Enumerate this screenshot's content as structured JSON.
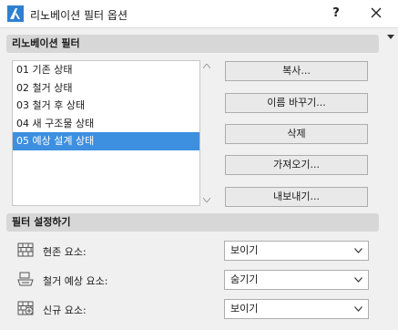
{
  "window": {
    "title": "리노베이션 필터 옵션",
    "help_label": "?"
  },
  "filters_section": {
    "header": "리노베이션 필터",
    "items": [
      {
        "label": "01 기존 상태"
      },
      {
        "label": "02 철거 상태"
      },
      {
        "label": "03 철거 후 상태"
      },
      {
        "label": "04 새 구조물 상태"
      },
      {
        "label": "05 예상 설계 상태"
      }
    ],
    "selected_index": 4
  },
  "buttons": {
    "copy": "복사...",
    "rename": "이름 바꾸기...",
    "delete": "삭제",
    "import": "가져오기...",
    "export": "내보내기..."
  },
  "settings_section": {
    "header": "필터 설정하기",
    "rows": [
      {
        "label": "현존 요소:",
        "value": "보이기",
        "icon": "existing-element-icon"
      },
      {
        "label": "철거 예상 요소:",
        "value": "숨기기",
        "icon": "demolished-element-icon"
      },
      {
        "label": "신규 요소:",
        "value": "보이기",
        "icon": "new-element-icon"
      }
    ]
  },
  "colors": {
    "selection": "#3d8fe0",
    "section_header": "#d7d7d7",
    "background": "#f0f0f0"
  }
}
